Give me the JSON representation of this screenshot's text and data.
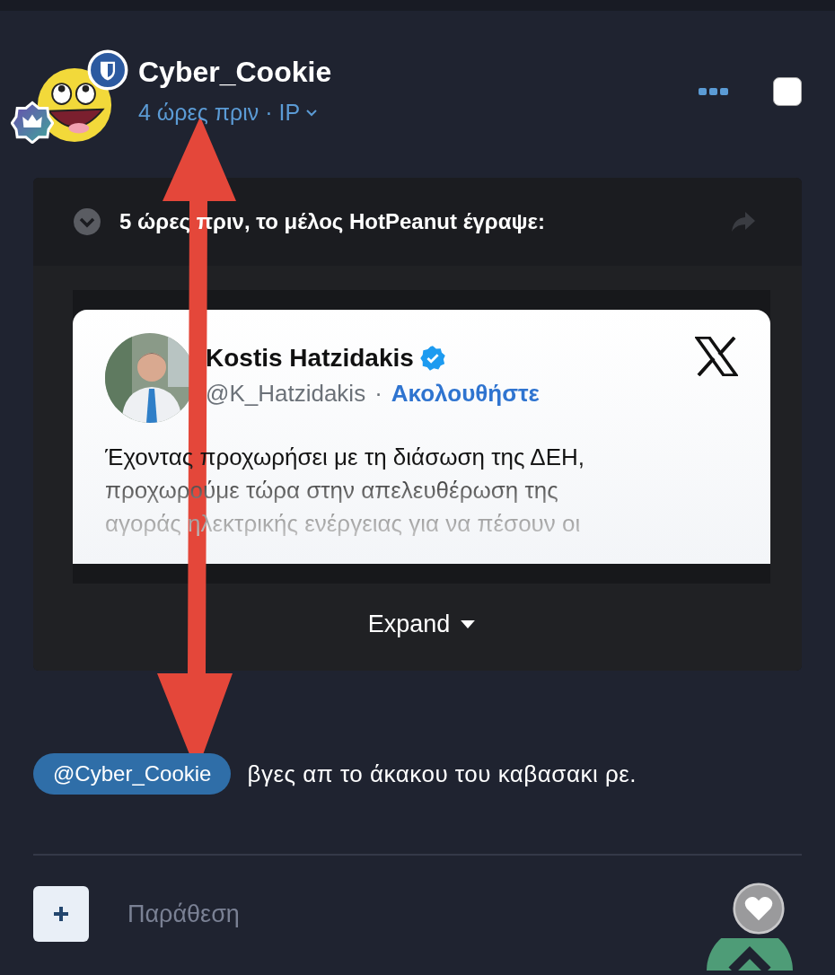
{
  "post": {
    "author": "Cyber_Cookie",
    "meta": "4 ώρες πριν · IP",
    "checked": false
  },
  "quote": {
    "header": "5 ώρες πριν, το μέλος HotPeanut έγραψε:",
    "tweet": {
      "name": "Kostis Hatzidakis",
      "handle": "@K_Hatzidakis",
      "separator": "·",
      "follow": "Ακολουθήστε",
      "text_lines": [
        "Έχοντας προχωρήσει με τη διάσωση της ΔΕΗ,",
        "προχωρούμε τώρα στην απελευθέρωση της",
        "αγοράς ηλεκτρικής ενέργειας για να πέσουν οι"
      ]
    },
    "expand": "Expand"
  },
  "reply": {
    "mention": "@Cyber_Cookie",
    "text": "βγες απ το άκακου του καβασακι ρε."
  },
  "composer": {
    "placeholder": "Παράθεση"
  }
}
